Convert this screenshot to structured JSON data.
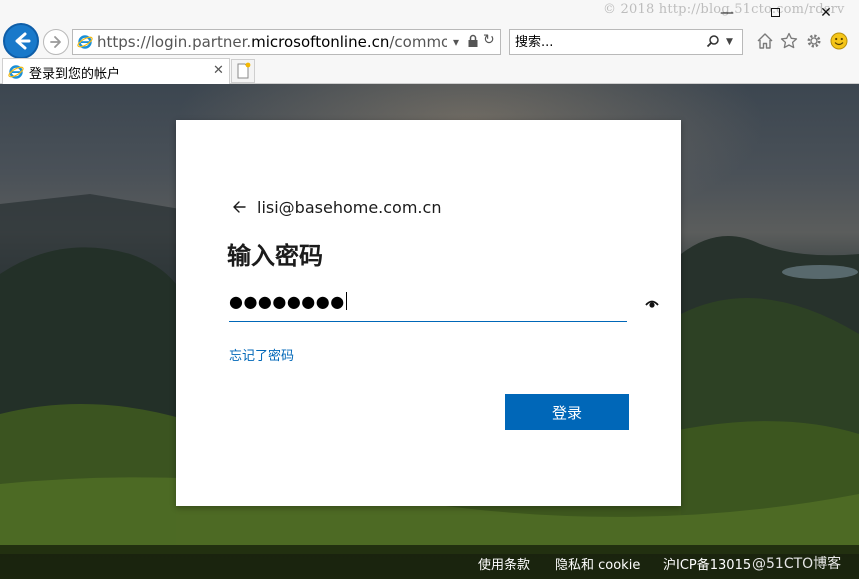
{
  "watermark": "© 2018 http://blog.51cto.com/rdsrv",
  "window": {
    "minimize": "—",
    "close": "✕"
  },
  "address_bar": {
    "url_prefix": "https://login.partner.",
    "url_domain": "microsoftonline.cn",
    "url_suffix": "/common/oa",
    "dropdown": "▾",
    "refresh": "↻"
  },
  "search": {
    "placeholder": "搜索..."
  },
  "tab": {
    "title": "登录到您的帐户",
    "close": "✕"
  },
  "login": {
    "email": "lisi@basehome.com.cn",
    "title": "输入密码",
    "password_mask": "●●●●●●●●",
    "forgot_link": "忘记了密码",
    "signin_button": "登录"
  },
  "footer": {
    "terms": "使用条款",
    "privacy": "隐私和 cookie",
    "icp": "沪ICP备13015",
    "blog": "@51CTO博客"
  },
  "colors": {
    "accent": "#0067b8",
    "back_button": "#1979ca"
  }
}
